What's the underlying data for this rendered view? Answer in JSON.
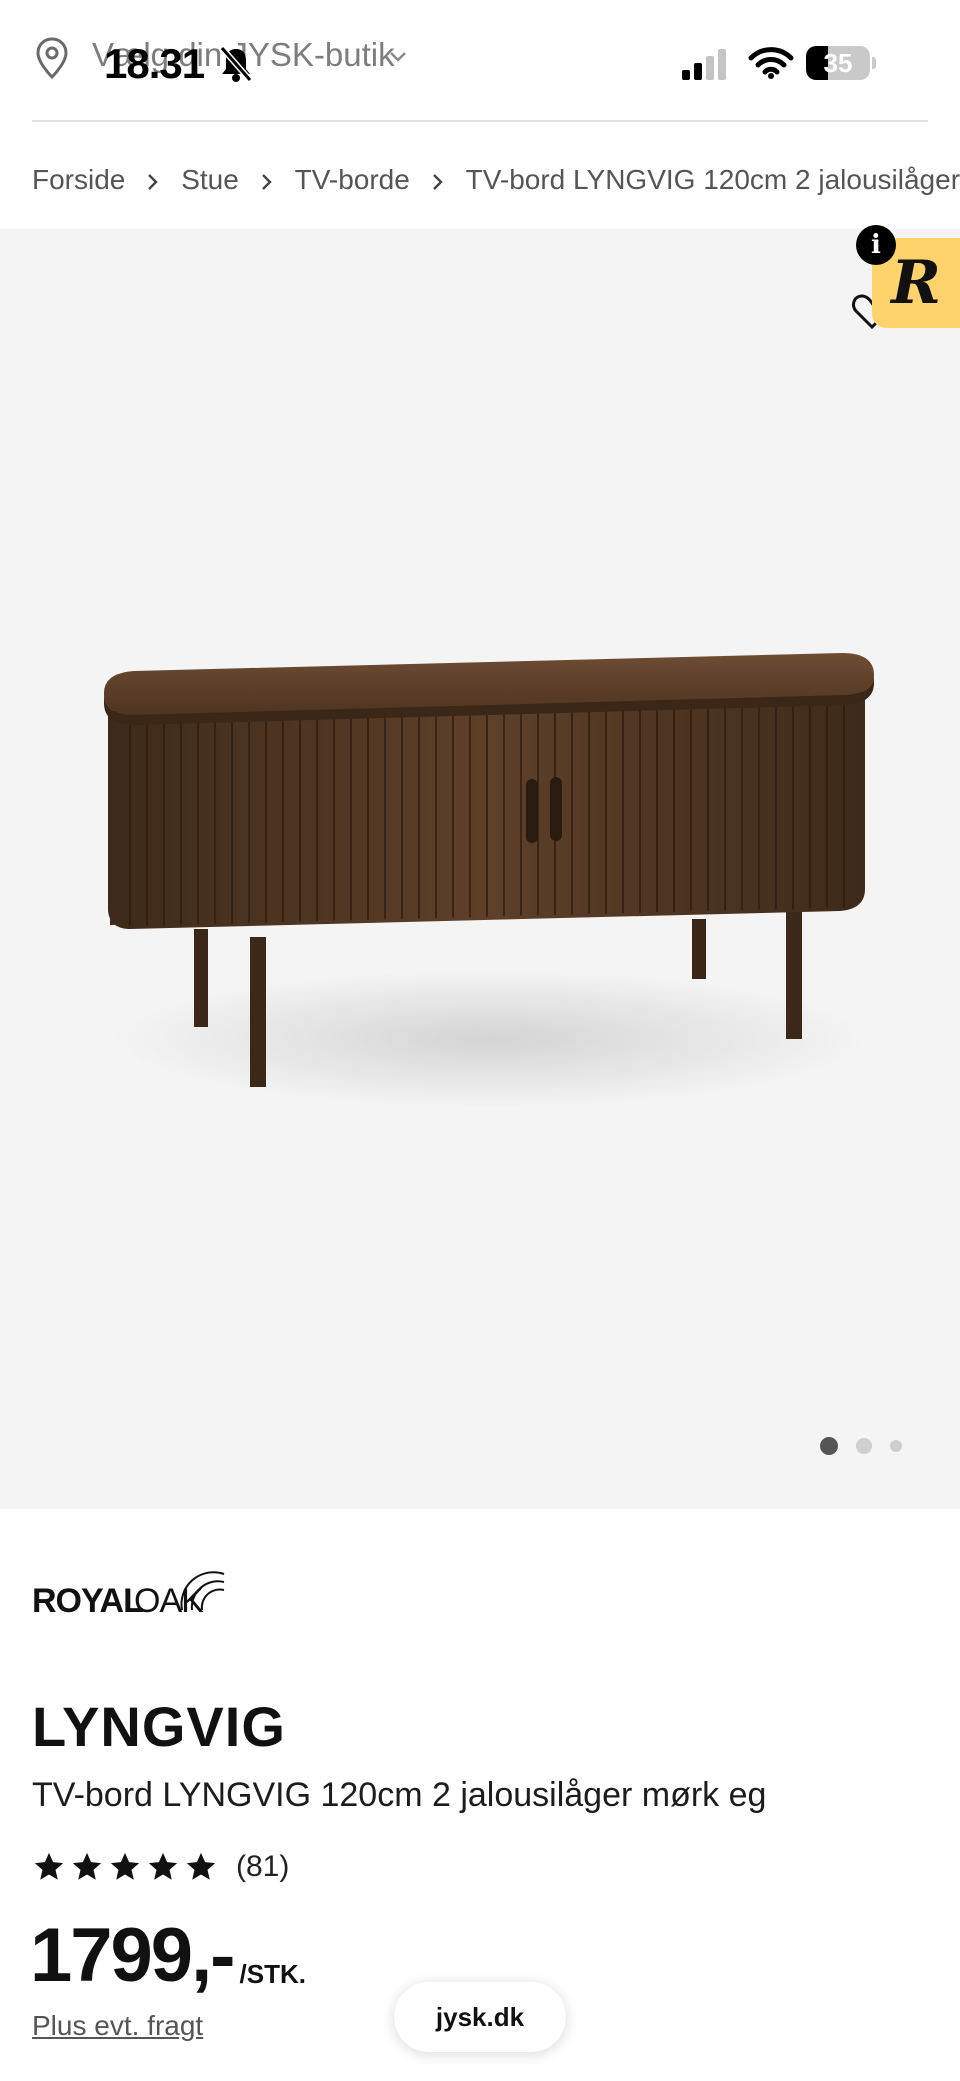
{
  "store_selector": {
    "label": "Vælg din JYSK-butik",
    "icon": "location-pin-icon"
  },
  "status_bar": {
    "time": "18.31",
    "battery_level": 35,
    "battery_text": "35"
  },
  "breadcrumb": [
    "Forside",
    "Stue",
    "TV-borde",
    "TV-bord LYNGVIG 120cm 2 jalousilåger"
  ],
  "gallery": {
    "image_count": 3,
    "active_index": 0,
    "badge_letter": "R",
    "info_letter": "i"
  },
  "product": {
    "brand": "ROYAL OAK",
    "family": "LYNGVIG",
    "description": "TV-bord LYNGVIG 120cm 2 jalousilåger mørk eg",
    "rating_stars": 5,
    "rating_count": "(81)",
    "price": "1799,-",
    "unit": "/STK.",
    "freight_link": "Plus evt. fragt"
  },
  "browser": {
    "url": "jysk.dk"
  },
  "colors": {
    "background": "#ffffff",
    "gallery_bg": "#f4f4f4",
    "badge": "#ffd36b",
    "wood": "#5a3d26"
  }
}
